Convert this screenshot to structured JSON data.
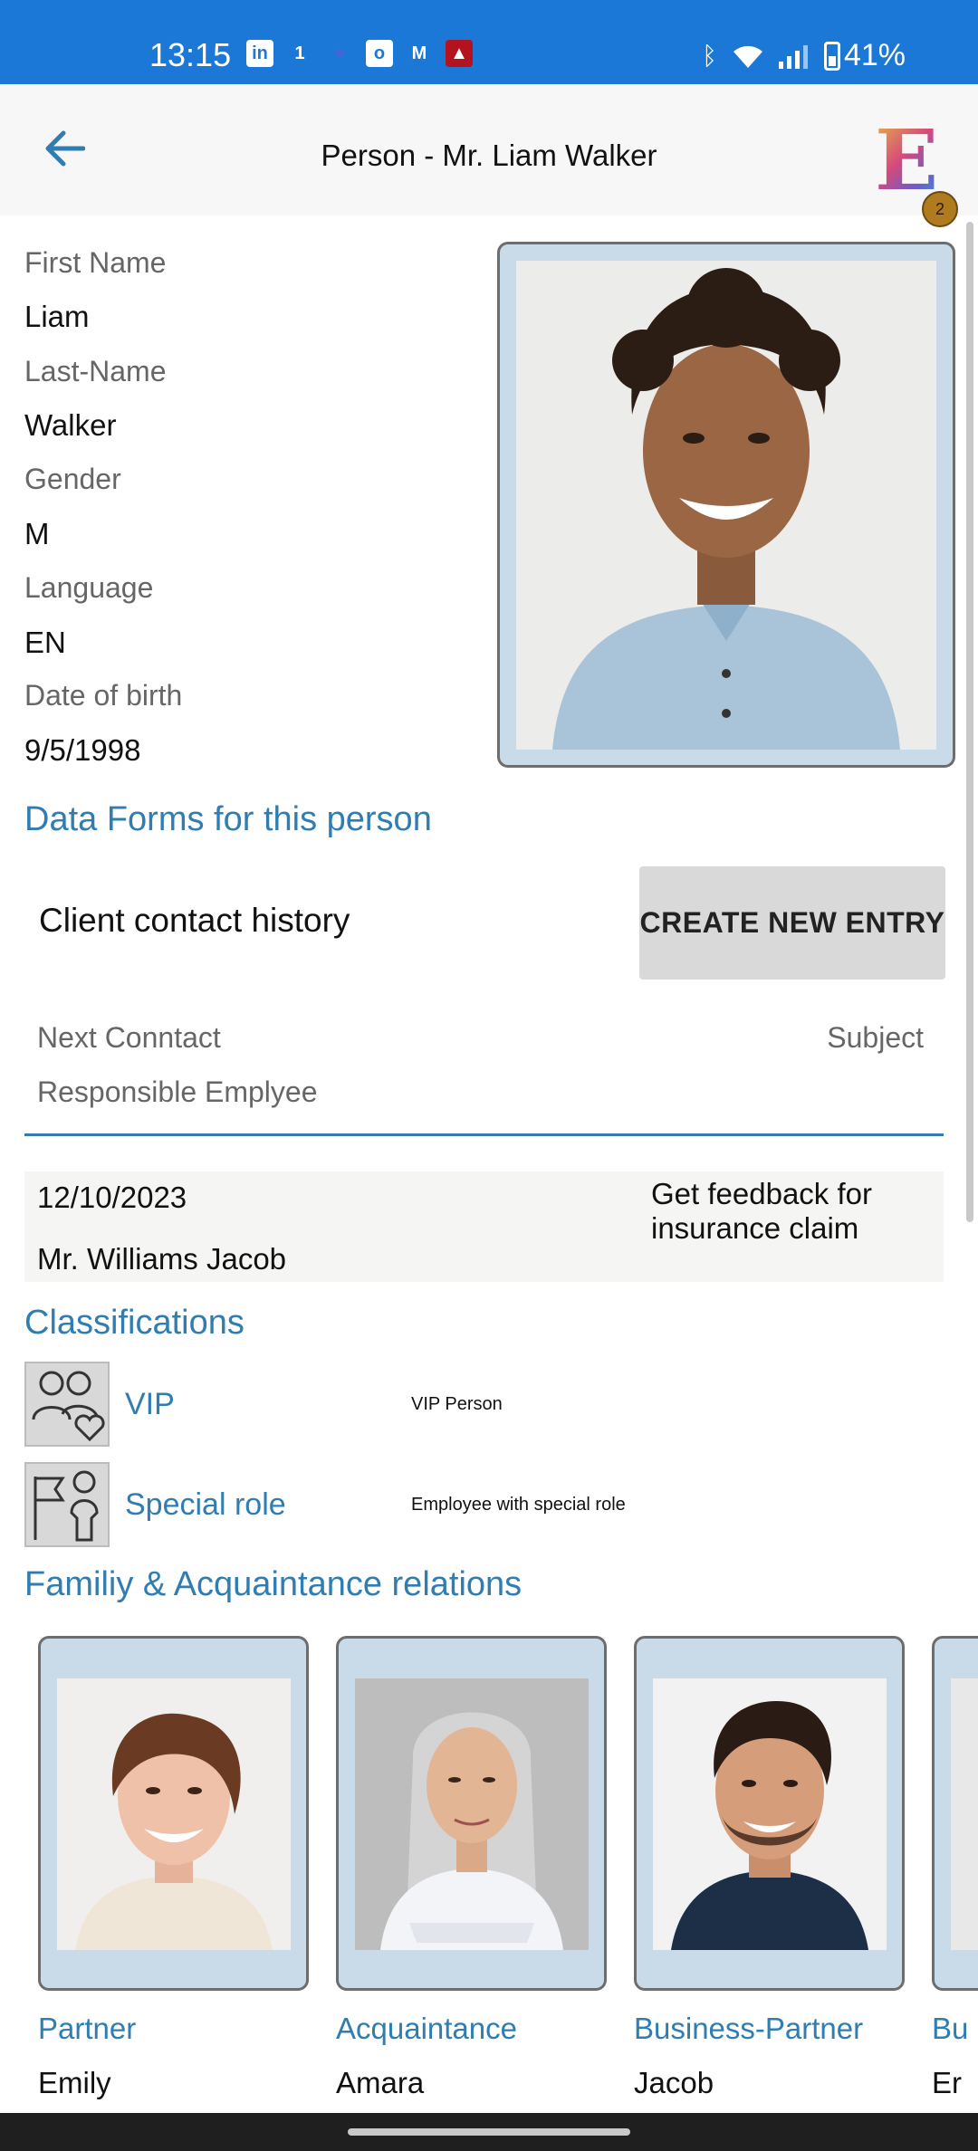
{
  "status_bar": {
    "time": "13:15",
    "notification_icons": [
      "linkedin-icon",
      "one-icon",
      "gemini-icon",
      "outlook-icon",
      "gmail-icon",
      "app-icon"
    ],
    "battery": "41%"
  },
  "app_bar": {
    "title": "Person - Mr. Liam Walker",
    "logo_letter": "E",
    "badge_count": "2"
  },
  "person": {
    "first_name_label": "First Name",
    "first_name": "Liam",
    "last_name_label": "Last-Name",
    "last_name": "Walker",
    "gender_label": "Gender",
    "gender": "M",
    "language_label": "Language",
    "language": "EN",
    "dob_label": "Date of birth",
    "dob": "9/5/1998"
  },
  "data_forms": {
    "title": "Data Forms for this person",
    "form_name": "Client contact history",
    "create_button": "CREATE NEW ENTRY",
    "columns": {
      "next_contact": "Next Conntact",
      "subject": "Subject",
      "responsible": "Responsible Emplyee"
    },
    "entries": [
      {
        "date": "12/10/2023",
        "subject_line1": "Get feedback for",
        "subject_line2": "insurance claim",
        "employee": "Mr. Williams Jacob"
      }
    ]
  },
  "classifications": {
    "title": "Classifications",
    "items": [
      {
        "name": "VIP",
        "description": "VIP Person",
        "icon": "people-heart-icon"
      },
      {
        "name": "Special role",
        "description": "Employee with special role",
        "icon": "flag-person-icon"
      }
    ]
  },
  "relations": {
    "title": "Familiy & Acquaintance relations",
    "items": [
      {
        "type": "Partner",
        "name": "Emily"
      },
      {
        "type": "Acquaintance",
        "name": "Amara"
      },
      {
        "type": "Business-Partner",
        "name": "Jacob"
      },
      {
        "type": "Bu",
        "name": "Er"
      }
    ]
  },
  "colors": {
    "status_bar": "#1c78d6",
    "accent": "#2f7db1",
    "photo_frame": "#c9dbe9"
  }
}
